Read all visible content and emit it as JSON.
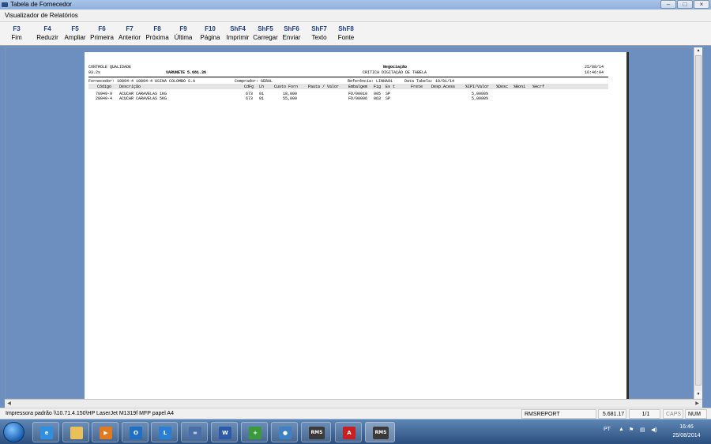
{
  "window": {
    "title": "Tabela de Fornecedor"
  },
  "menu": {
    "label": "Visualizador de Relatórios"
  },
  "toolbar": [
    {
      "key": "F3",
      "label": "Fim"
    },
    {
      "key": "F4",
      "label": "Reduzir"
    },
    {
      "key": "F5",
      "label": "Ampliar"
    },
    {
      "key": "F6",
      "label": "Primeira"
    },
    {
      "key": "F7",
      "label": "Anterior"
    },
    {
      "key": "F8",
      "label": "Próxima"
    },
    {
      "key": "F9",
      "label": "Última"
    },
    {
      "key": "F10",
      "label": "Página"
    },
    {
      "key": "ShF4",
      "label": "Imprimir"
    },
    {
      "key": "ShF5",
      "label": "Carregar"
    },
    {
      "key": "ShF6",
      "label": "Enviar"
    },
    {
      "key": "ShF7",
      "label": "Texto"
    },
    {
      "key": "ShF8",
      "label": "Fonte"
    }
  ],
  "report": {
    "company": "CONTROLE QUALIDADE",
    "version": "03.2s",
    "vendor_total": "VARUNETE 5.681.36",
    "header_right_title": "Negociação",
    "header_subtitle": "CRITICA DIGITAÇÃO DE TABELA",
    "date": "25/08/14",
    "time": "16:46:04",
    "supplier": "Fornecedor: 10894-4 10894-4 USINA COLOMBO S.A",
    "buyer": "Comprador: GERAL",
    "reference": "Referência: LINHA01",
    "table_date": "Data Tabela: 10/01/14",
    "columns": {
      "codigo": "Código",
      "descricao": "Descrição",
      "cdfg": "CdFg",
      "lh": "Lh",
      "custo_forn": "Custo Forn",
      "pauta_valor": "Pauta / Valor",
      "embalagem": "Embalgem",
      "fig": "Fig",
      "est": "Es t",
      "frete": "Frete",
      "desp_acess": "Desp.Acess",
      "ipi_valor": "%IPI/Valor",
      "desc": "%Desc",
      "boni": "%Boni",
      "acrf": "%Acrf"
    },
    "rows": [
      {
        "codigo": "70949-9",
        "descricao": "ACUCAR CARAVELAS 1KG",
        "cdfg": "673",
        "lh": "01",
        "custo_forn": "18,000",
        "embalagem": "FD/00010",
        "fig": "005",
        "est": "SP",
        "ipi_valor": "5,0000%"
      },
      {
        "codigo": "28040-4",
        "descricao": "ACUCAR CARAVELAS 5KG",
        "cdfg": "673",
        "lh": "01",
        "custo_forn": "55,000",
        "embalagem": "FD/00006",
        "fig": "063",
        "est": "SP",
        "ipi_valor": "5,0000%"
      }
    ]
  },
  "status": {
    "printer": "Impressora padrão \\\\10.71.4.150\\HP LaserJet M1319f MFP papel A4",
    "module": "RMSREPORT",
    "value": "5.681.17",
    "page": "1/1",
    "caps": "CAPS",
    "num": "NUM"
  },
  "taskbar": {
    "apps": [
      {
        "name": "ie",
        "label": "e",
        "color": "#2f8fe0"
      },
      {
        "name": "folder",
        "label": "",
        "color": "#e9c05a"
      },
      {
        "name": "media",
        "label": "▶",
        "color": "#e07a20"
      },
      {
        "name": "outlook",
        "label": "O",
        "color": "#1f6fc4"
      },
      {
        "name": "lync",
        "label": "L",
        "color": "#2a7fd4"
      },
      {
        "name": "link",
        "label": "∞",
        "color": "#4a6fa8"
      },
      {
        "name": "word",
        "label": "W",
        "color": "#2b5aa8"
      },
      {
        "name": "installer",
        "label": "+",
        "color": "#3c9a3c"
      },
      {
        "name": "chat",
        "label": "●",
        "color": "#3f7fc4"
      },
      {
        "name": "rms1",
        "label": "RMS",
        "color": "#3a3a3a"
      },
      {
        "name": "pdf",
        "label": "A",
        "color": "#c82020"
      },
      {
        "name": "rms2",
        "label": "RMS",
        "color": "#3a3a3a"
      }
    ],
    "language": "PT",
    "time": "16:46",
    "date": "25/08/2014"
  }
}
